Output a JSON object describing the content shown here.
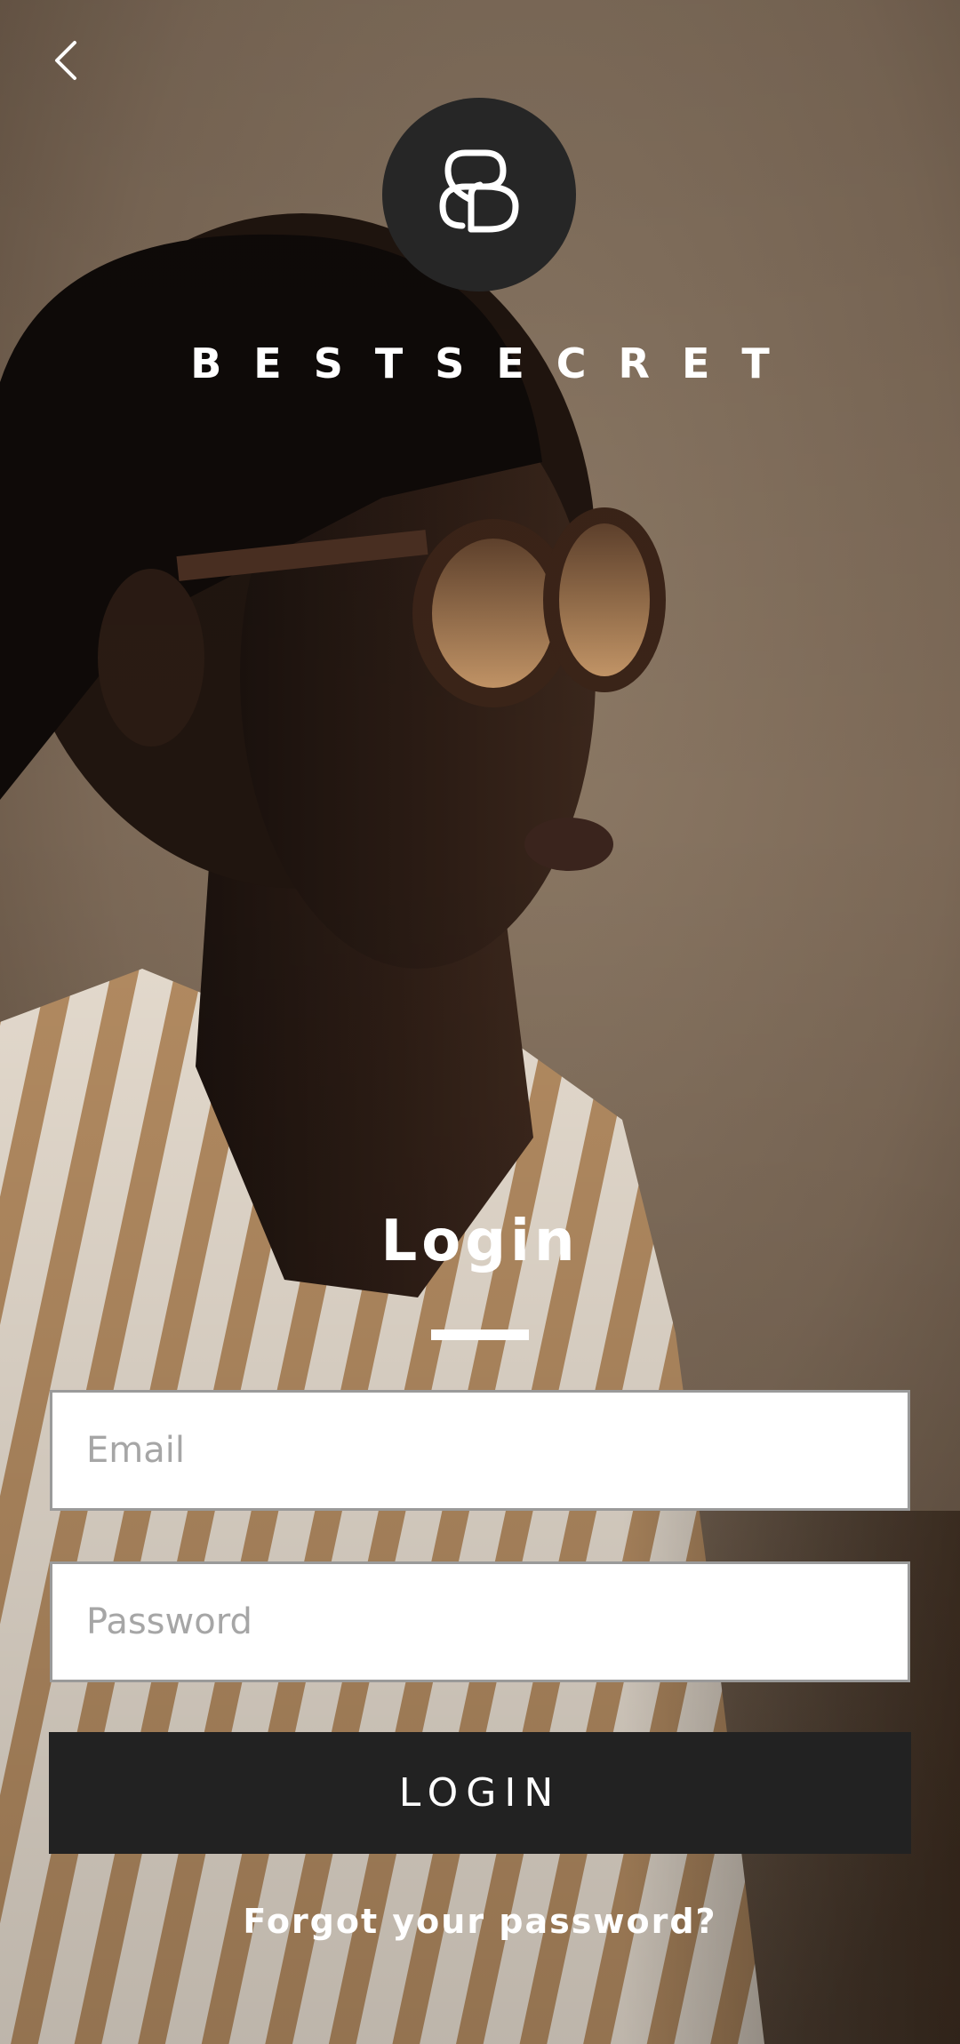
{
  "brand": {
    "name": "BESTSECRET",
    "logo_icon": "bestsecret-monogram-icon"
  },
  "navigation": {
    "back_icon": "chevron-left-icon"
  },
  "login_form": {
    "title": "Login",
    "email_placeholder": "Email",
    "password_placeholder": "Password",
    "submit_label": "LOGIN",
    "forgot_password_label": "Forgot your password?"
  },
  "colors": {
    "button_background": "#222222",
    "logo_background": "#262626",
    "text_on_dark": "#ffffff",
    "field_border": "#9a9a9a",
    "placeholder": "#a6a6a6"
  }
}
